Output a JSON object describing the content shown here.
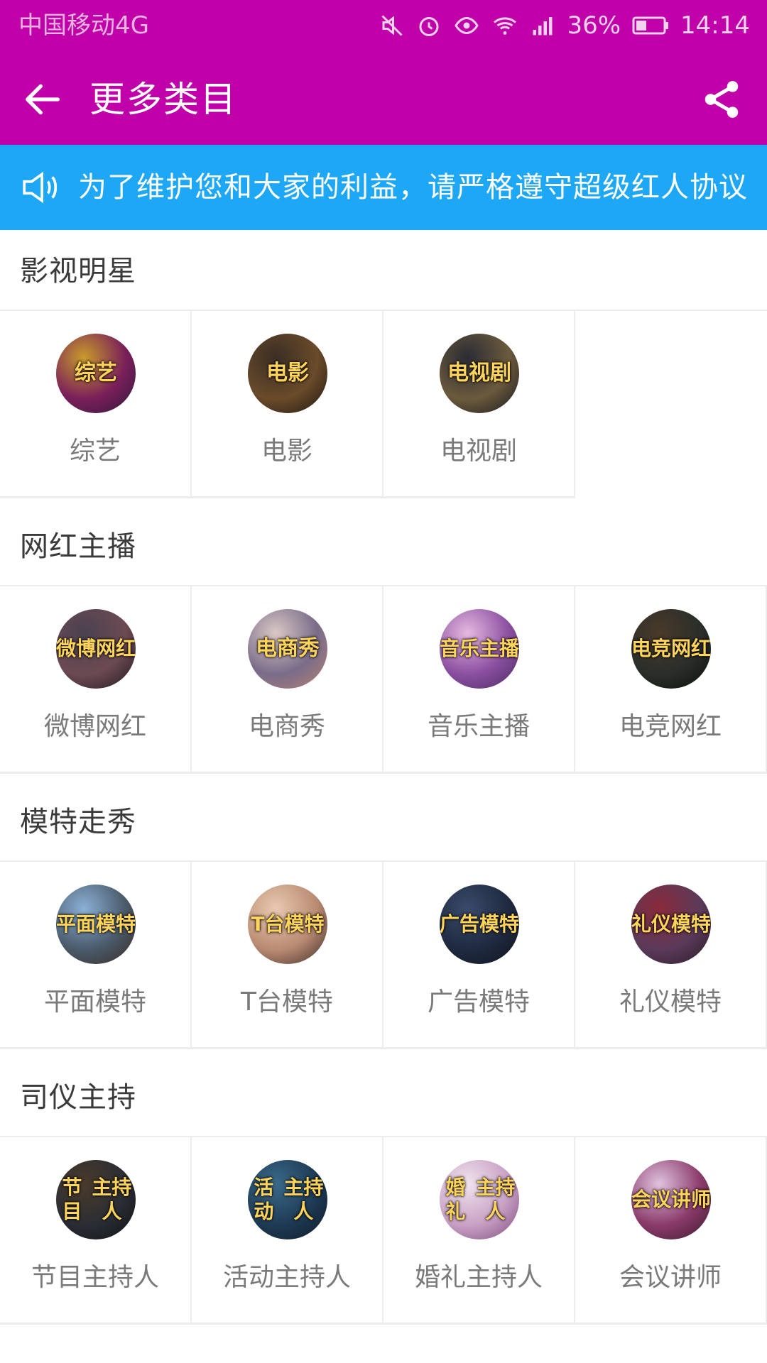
{
  "status_bar": {
    "carrier": "中国移动4G",
    "battery": "36%",
    "time": "14:14",
    "icons": [
      "mute-icon",
      "alarm-icon",
      "eye-icon",
      "wifi-icon",
      "signal-icon",
      "battery-icon"
    ]
  },
  "app_bar": {
    "title": "更多类目",
    "background": "#c000a8"
  },
  "notice": {
    "text": "为了维护您和大家的利益，请严格遵守超级红人协议",
    "background": "#1ea7f5"
  },
  "sections": [
    {
      "title": "影视明星",
      "items": [
        {
          "label": "综艺",
          "avatar_text": "综艺",
          "colors": [
            "#c79b2a",
            "#7a1f5a",
            "#2d1a3c"
          ]
        },
        {
          "label": "电影",
          "avatar_text": "电影",
          "colors": [
            "#3a2e24",
            "#6a4b2a",
            "#1a1410"
          ]
        },
        {
          "label": "电视剧",
          "avatar_text": "电视剧",
          "colors": [
            "#2a2c34",
            "#6b5a3d",
            "#15171c"
          ]
        }
      ]
    },
    {
      "title": "网红主播",
      "items": [
        {
          "label": "微博网红",
          "avatar_text": "微博\n网红",
          "colors": [
            "#4a4250",
            "#6c4a52",
            "#201820"
          ]
        },
        {
          "label": "电商秀",
          "avatar_text": "电商秀",
          "colors": [
            "#d9c8c4",
            "#7a6c8a",
            "#b78370"
          ]
        },
        {
          "label": "音乐主播",
          "avatar_text": "音乐\n主播",
          "colors": [
            "#e6b8e0",
            "#8a4fa0",
            "#4a2a60"
          ]
        },
        {
          "label": "电竞网红",
          "avatar_text": "电竞\n网红",
          "colors": [
            "#4a3a2a",
            "#2a2e2a",
            "#0c0c0c"
          ]
        }
      ]
    },
    {
      "title": "模特走秀",
      "items": [
        {
          "label": "平面模特",
          "avatar_text": "平面\n模特",
          "colors": [
            "#8ab0d6",
            "#4a5a6a",
            "#3a2a20"
          ]
        },
        {
          "label": "T台模特",
          "avatar_text": "T台\n模特",
          "colors": [
            "#e8c9b0",
            "#b98a72",
            "#3a2a26"
          ]
        },
        {
          "label": "广告模特",
          "avatar_text": "广告\n模特",
          "colors": [
            "#3a4a6a",
            "#1e2a40",
            "#12151c"
          ]
        },
        {
          "label": "礼仪模特",
          "avatar_text": "礼仪\n模特",
          "colors": [
            "#8a2a3a",
            "#5a3a5a",
            "#2a1a24"
          ]
        }
      ]
    },
    {
      "title": "司仪主持",
      "items": [
        {
          "label": "节目主持人",
          "avatar_text": "节目\n主持人",
          "colors": [
            "#4a3a2a",
            "#2a2e34",
            "#0e1012"
          ]
        },
        {
          "label": "活动主持人",
          "avatar_text": "活动\n主持人",
          "colors": [
            "#3a6a8a",
            "#1e3a54",
            "#0e1a26"
          ]
        },
        {
          "label": "婚礼主持人",
          "avatar_text": "婚礼\n主持人",
          "colors": [
            "#f0e4ee",
            "#c8a0c4",
            "#7a4a7a"
          ]
        },
        {
          "label": "会议讲师",
          "avatar_text": "会议\n讲师",
          "colors": [
            "#e0c2de",
            "#8a3a6a",
            "#3a1a2a"
          ]
        }
      ]
    }
  ]
}
